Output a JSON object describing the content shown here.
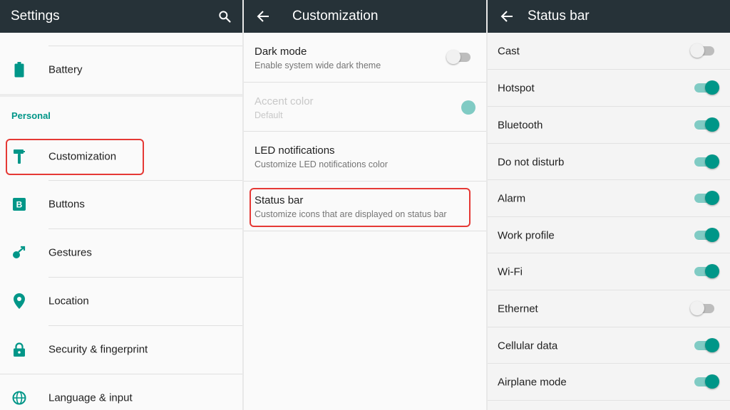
{
  "colors": {
    "appbar": "#263238",
    "accent": "#009688",
    "accent_light": "#80cbc4",
    "highlight": "#e53935"
  },
  "settings_panel": {
    "title": "Settings",
    "search_icon": "search-icon",
    "battery_label": "Battery",
    "category_personal": "Personal",
    "items": [
      {
        "label": "Customization",
        "icon": "paint-roller-icon",
        "highlighted": true
      },
      {
        "label": "Buttons",
        "icon": "buttons-b-icon"
      },
      {
        "label": "Gestures",
        "icon": "gesture-icon"
      },
      {
        "label": "Location",
        "icon": "location-pin-icon"
      },
      {
        "label": "Security & fingerprint",
        "icon": "lock-icon"
      },
      {
        "label": "Language & input",
        "icon": "globe-icon"
      }
    ]
  },
  "customization_panel": {
    "title": "Customization",
    "back_icon": "back-arrow-icon",
    "items": [
      {
        "title": "Dark mode",
        "subtitle": "Enable system wide dark theme",
        "control": "switch",
        "enabled": false
      },
      {
        "title": "Accent color",
        "subtitle": "Default",
        "control": "color-dot",
        "disabled": true
      },
      {
        "title": "LED notifications",
        "subtitle": "Customize LED notifications color"
      },
      {
        "title": "Status bar",
        "subtitle": "Customize icons that are displayed on status bar",
        "highlighted": true
      }
    ]
  },
  "statusbar_panel": {
    "title": "Status bar",
    "back_icon": "back-arrow-icon",
    "items": [
      {
        "label": "Cast",
        "enabled": false
      },
      {
        "label": "Hotspot",
        "enabled": true
      },
      {
        "label": "Bluetooth",
        "enabled": true
      },
      {
        "label": "Do not disturb",
        "enabled": true
      },
      {
        "label": "Alarm",
        "enabled": true
      },
      {
        "label": "Work profile",
        "enabled": true
      },
      {
        "label": "Wi-Fi",
        "enabled": true
      },
      {
        "label": "Ethernet",
        "enabled": false
      },
      {
        "label": "Cellular data",
        "enabled": true
      },
      {
        "label": "Airplane mode",
        "enabled": true
      }
    ]
  }
}
